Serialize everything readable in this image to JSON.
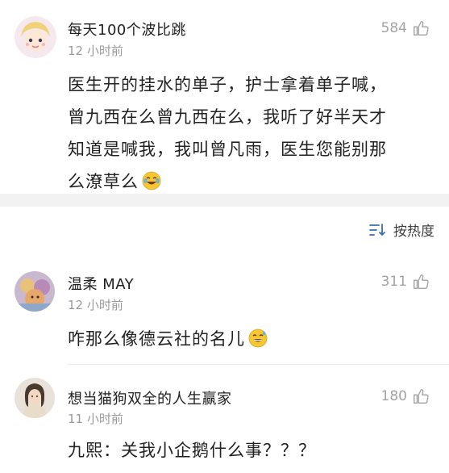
{
  "post": {
    "username": "每天100个波比跳",
    "time": "12 小时前",
    "likes": "584",
    "text_lines": [
      "医生开的挂水的单子，护士拿着单子喊，",
      "曾九西在么曾九西在么，我听了好半天才",
      "知道是喊我，我叫曾凡雨，医生您能别那",
      "么潦草么"
    ],
    "emoji": "face-with-tears-of-joy-icon"
  },
  "sort": {
    "label": "按热度",
    "icon": "sort-icon"
  },
  "comments": [
    {
      "username": "温柔 MAY",
      "time": "12 小时前",
      "likes": "311",
      "text": "咋那么像德云社的名儿",
      "emoji": "grinning-sweat-emoji-icon"
    },
    {
      "username": "想当猫狗双全的人生赢家",
      "time": "11 小时前",
      "likes": "180",
      "text": "九熙：关我小企鹅什么事？？？"
    }
  ],
  "colors": {
    "accent": "#3b6bb5",
    "muted": "#9a9a9a",
    "divider": "#f2f2f2"
  }
}
